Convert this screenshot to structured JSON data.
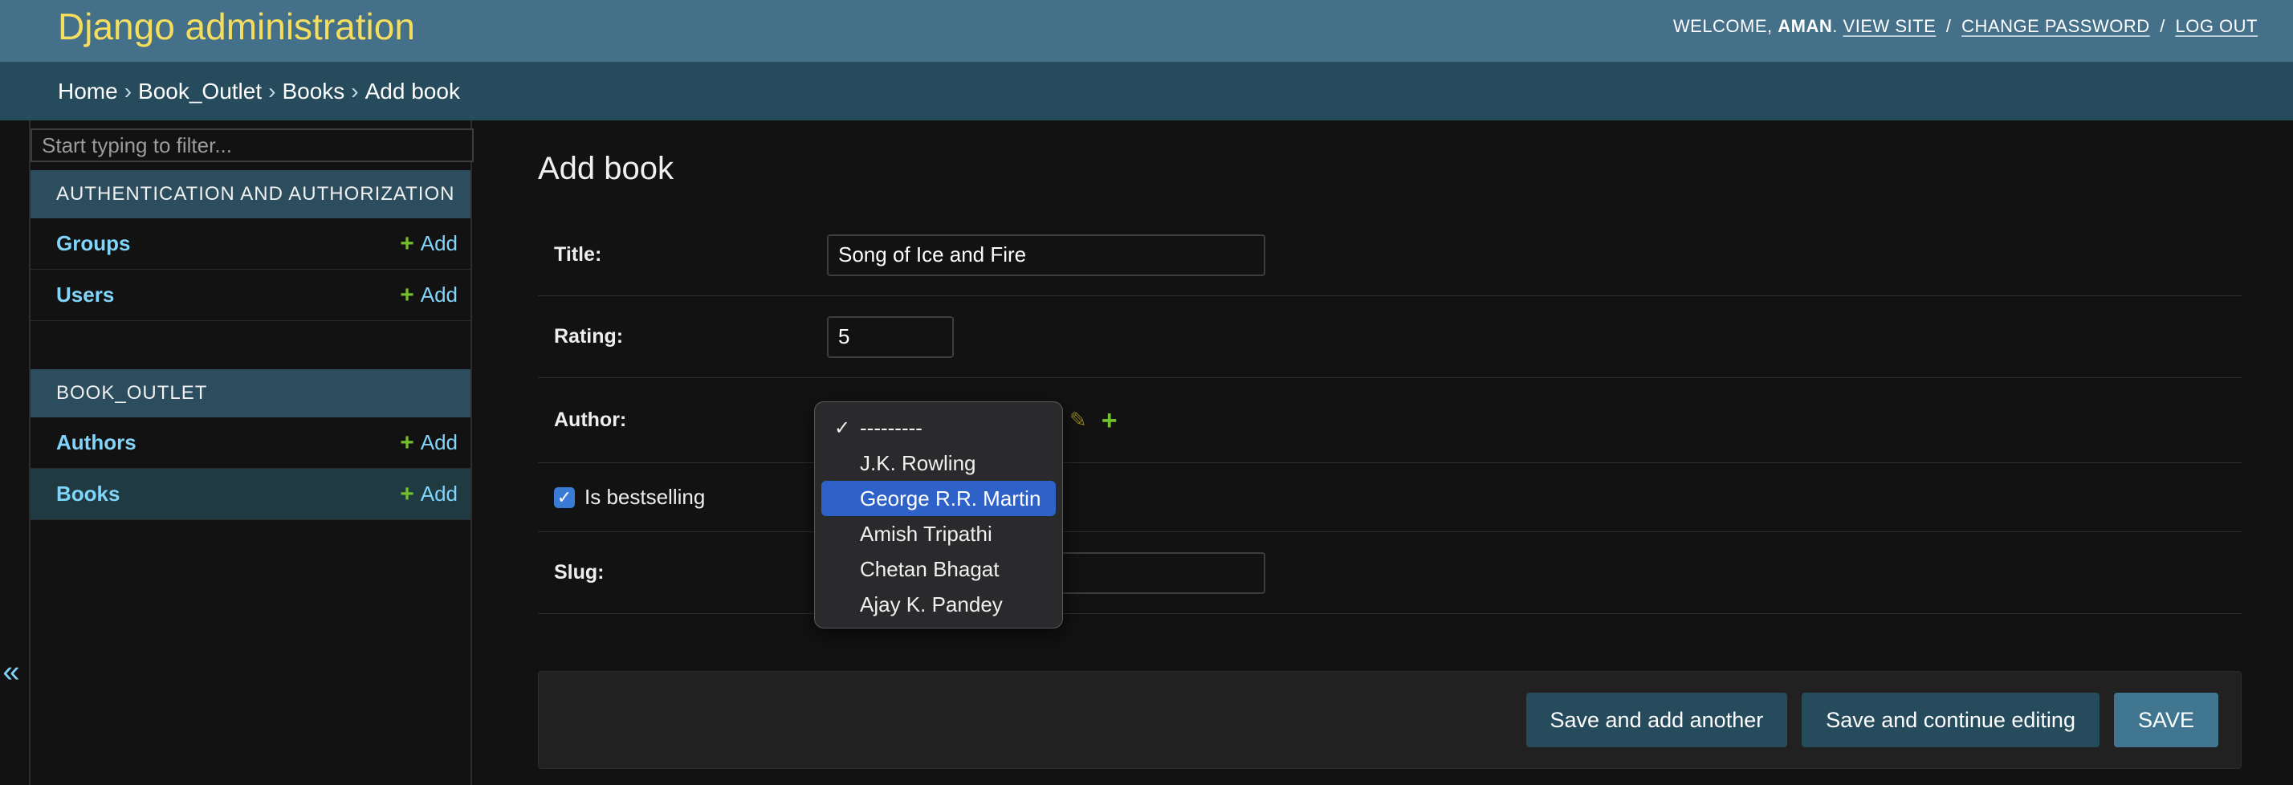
{
  "header": {
    "branding": "Django administration",
    "welcome": "Welcome,",
    "username": "aman",
    "view_site": "View site",
    "change_password": "Change password",
    "log_out": "Log out",
    "separator": "/"
  },
  "breadcrumbs": {
    "items": [
      "Home",
      "Book_Outlet",
      "Books"
    ],
    "current": "Add book",
    "separator": "›"
  },
  "sidebar": {
    "filter_placeholder": "Start typing to filter...",
    "collapse_glyph": "«",
    "modules": [
      {
        "caption": "Authentication and Authorization",
        "models": [
          {
            "name": "Groups",
            "add": "Add"
          },
          {
            "name": "Users",
            "add": "Add"
          }
        ]
      },
      {
        "caption": "Book_Outlet",
        "models": [
          {
            "name": "Authors",
            "add": "Add"
          },
          {
            "name": "Books",
            "add": "Add",
            "current": true
          }
        ]
      }
    ]
  },
  "main": {
    "title": "Add book",
    "fields": {
      "title": {
        "label": "Title:",
        "value": "Song of Ice and Fire"
      },
      "rating": {
        "label": "Rating:",
        "value": "5"
      },
      "author": {
        "label": "Author:"
      },
      "is_bestselling": {
        "label": "Is bestselling",
        "checked": true
      },
      "slug": {
        "label": "Slug:",
        "value": ""
      }
    },
    "author_dropdown": {
      "options": [
        "---------",
        "J.K. Rowling",
        "George R.R. Martin",
        "Amish Tripathi",
        "Chetan Bhagat",
        "Ajay K. Pandey"
      ],
      "checked_index": 0,
      "highlighted_index": 2
    },
    "buttons": {
      "save_add_another": "Save and add another",
      "save_continue": "Save and continue editing",
      "save": "SAVE"
    }
  },
  "colors": {
    "header_bg": "#44708a",
    "branding": "#f5dd5d",
    "breadcrumbs_bg": "#264b5d",
    "link": "#81d4fa",
    "add_plus": "#70bf2b",
    "highlight": "#2f62c8"
  }
}
